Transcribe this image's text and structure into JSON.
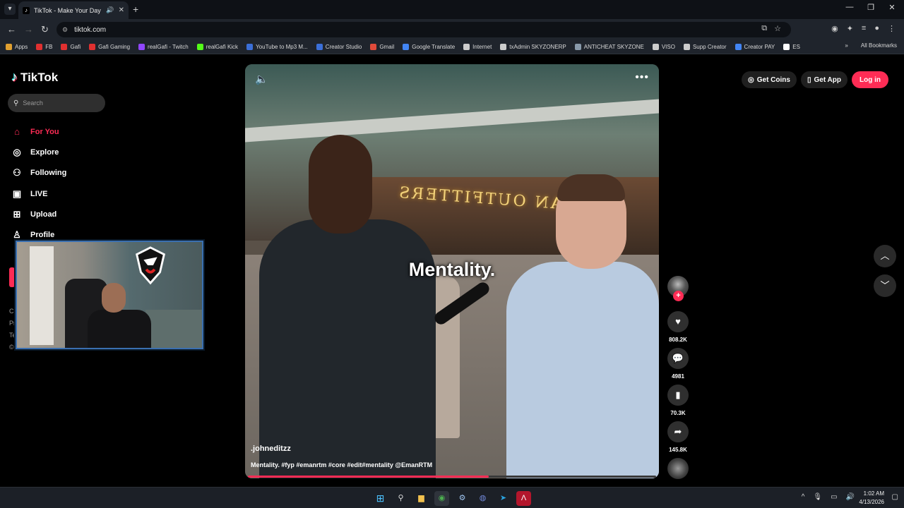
{
  "browser": {
    "tab_title": "TikTok - Make Your Day",
    "url": "tiktok.com",
    "bookmarks": [
      {
        "label": "Apps",
        "color": "#e0a030"
      },
      {
        "label": "FB",
        "color": "#e03030"
      },
      {
        "label": "Gafi",
        "color": "#e03030"
      },
      {
        "label": "Gafi Gaming",
        "color": "#e03030"
      },
      {
        "label": "realGafi - Twitch",
        "color": "#9146ff"
      },
      {
        "label": "realGafi Kick",
        "color": "#53fc18"
      },
      {
        "label": "YouTube to Mp3 M...",
        "color": "#3b6fd8"
      },
      {
        "label": "Creator Studio",
        "color": "#3b6fd8"
      },
      {
        "label": "Gmail",
        "color": "#e04a3a"
      },
      {
        "label": "Google Translate",
        "color": "#4285f4"
      },
      {
        "label": "Internet",
        "color": "#cccccc"
      },
      {
        "label": "txAdmin SKYZONERP",
        "color": "#cccccc"
      },
      {
        "label": "ANTICHEAT SKYZONE",
        "color": "#8899aa"
      },
      {
        "label": "VISO",
        "color": "#cccccc"
      },
      {
        "label": "Supp Creator",
        "color": "#cccccc"
      },
      {
        "label": "Creator PAY",
        "color": "#4285f4"
      },
      {
        "label": "ES",
        "color": "#ffffff"
      }
    ],
    "all_bookmarks": "All Bookmarks"
  },
  "sidebar": {
    "logo_text": "TikTok",
    "search_placeholder": "Search",
    "nav": [
      {
        "label": "For You",
        "icon": "home-icon",
        "active": true
      },
      {
        "label": "Explore",
        "icon": "compass-icon",
        "active": false
      },
      {
        "label": "Following",
        "icon": "user-follow-icon",
        "active": false
      },
      {
        "label": "LIVE",
        "icon": "live-tv-icon",
        "active": false
      },
      {
        "label": "Upload",
        "icon": "upload-plus-icon",
        "active": false
      },
      {
        "label": "Profile",
        "icon": "profile-icon",
        "active": false
      }
    ],
    "fragments": [
      "C",
      "Pr",
      "Te",
      "©"
    ]
  },
  "video": {
    "caption": "Mentality.",
    "author": ".johneditzz",
    "description": "Mentality. #fyp #emanrtm #core #edit#mentality @EmanRTM",
    "progress": 0.59,
    "sign_text": "URBAN OUTFITTERS"
  },
  "actions": {
    "likes": "808.2K",
    "comments": "4981",
    "saves": "70.3K",
    "shares": "145.8K"
  },
  "topbar": {
    "get_coins": "Get Coins",
    "get_app": "Get App",
    "login": "Log in"
  },
  "taskbar": {
    "time": "1:02 AM",
    "date": "4/13/2026"
  },
  "colors": {
    "accent": "#fe2c55"
  }
}
